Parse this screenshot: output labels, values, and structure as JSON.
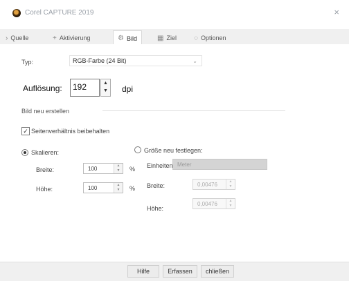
{
  "window": {
    "title": "Corel CAPTURE 2019",
    "close_glyph": "×"
  },
  "tabs": [
    {
      "label": "Quelle",
      "icon": "chevron-right-icon",
      "glyph": "›"
    },
    {
      "label": "Aktivierung",
      "icon": "plus-icon",
      "glyph": "+"
    },
    {
      "label": "Bild",
      "icon": "gear-icon",
      "glyph": "⚙"
    },
    {
      "label": "Ziel",
      "icon": "grid-icon",
      "glyph": "▦"
    },
    {
      "label": "Optionen",
      "icon": "circle-icon",
      "glyph": "◌"
    }
  ],
  "type_row": {
    "label": "Typ:",
    "value": "RGB-Farbe (24 Bit)",
    "arrow": "⌄"
  },
  "resolution": {
    "label": "Auflösung:",
    "value": "192",
    "unit": "dpi",
    "up": "▲",
    "down": "▼"
  },
  "group": {
    "label": "Bild neu erstellen"
  },
  "keep_ratio": {
    "label": "Seitenverhältnis beibehalten",
    "check": "✓"
  },
  "scale": {
    "label": "Skalieren:",
    "width_label": "Breite:",
    "width_value": "100",
    "width_unit": "%",
    "height_label": "Höhe:",
    "height_value": "100",
    "height_unit": "%"
  },
  "new_size": {
    "label": "Größe neu festlegen:",
    "units_label": "Einheiten:",
    "units_value": "Meter",
    "width_label": "Breite:",
    "width_value": "0,00476",
    "height_label": "Höhe:",
    "height_value": "0,00476"
  },
  "spin_glyphs": {
    "up": "▲",
    "down": "▼"
  },
  "footer": {
    "help": "Hilfe",
    "capture": "Erfassen",
    "close": "chließen"
  }
}
